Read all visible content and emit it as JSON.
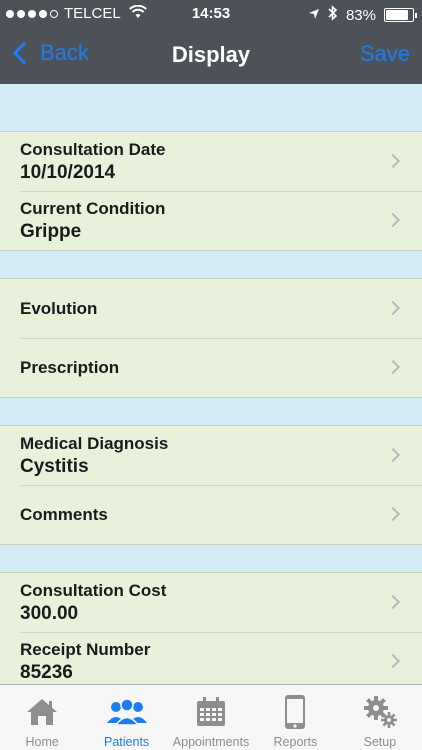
{
  "status": {
    "carrier": "TELCEL",
    "time": "14:53",
    "battery": "83%",
    "battery_level": 0.83
  },
  "nav": {
    "back_label": "Back",
    "title": "Display",
    "save_label": "Save"
  },
  "sections": {
    "consultation": {
      "date_label": "Consultation Date",
      "date_value": "10/10/2014",
      "condition_label": "Current Condition",
      "condition_value": "Grippe"
    },
    "treatment": {
      "evolution_label": "Evolution",
      "prescription_label": "Prescription"
    },
    "diagnosis": {
      "diagnosis_label": "Medical Diagnosis",
      "diagnosis_value": "Cystitis",
      "comments_label": "Comments"
    },
    "billing": {
      "cost_label": "Consultation Cost",
      "cost_value": "300.00",
      "receipt_label": "Receipt Number",
      "receipt_value": "85236"
    }
  },
  "tabs": [
    {
      "label": "Home",
      "icon": "home-icon",
      "active": false
    },
    {
      "label": "Patients",
      "icon": "patients-icon",
      "active": true
    },
    {
      "label": "Appointments",
      "icon": "calendar-icon",
      "active": false
    },
    {
      "label": "Reports",
      "icon": "phone-icon",
      "active": false
    },
    {
      "label": "Setup",
      "icon": "gear-icon",
      "active": false
    }
  ],
  "colors": {
    "nav_background": "#4c5257",
    "accent": "#1e7cf2",
    "row_background": "#e8f2db",
    "section_spacer": "#d4ebf8",
    "tab_inactive": "#8e8e8e"
  }
}
